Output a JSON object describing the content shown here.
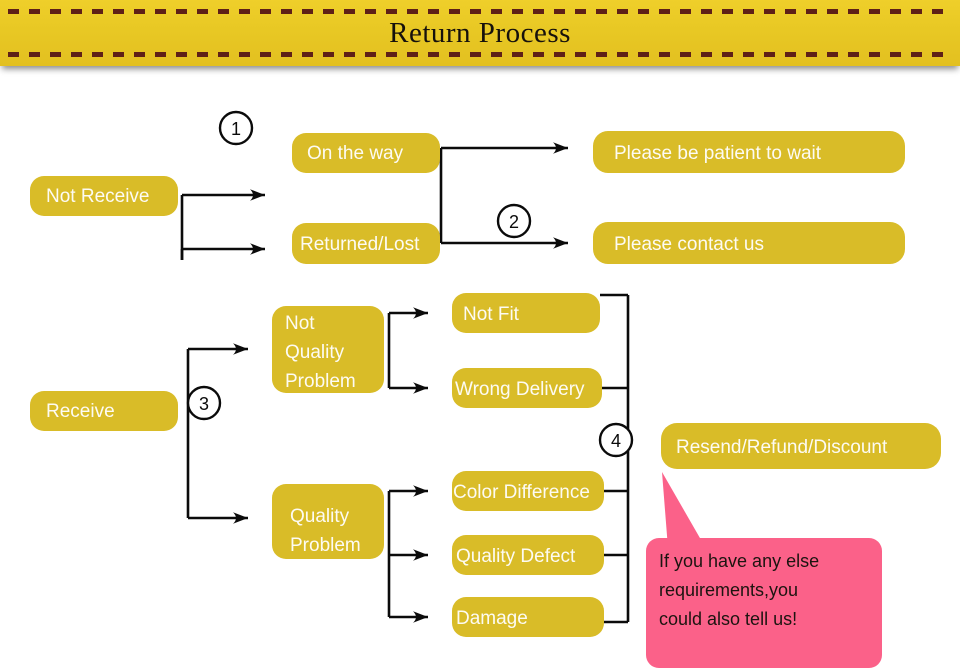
{
  "banner": {
    "title": "Return Process",
    "background_color": "#e8c824",
    "dash_color": "#5e2017"
  },
  "theme": {
    "node_color": "#d9bc28",
    "node_text_color": "#fdfbf3",
    "connector_color": "#0b0b0b",
    "bubble_color": "#fb6189",
    "bubble_text_color": "#1c1410"
  },
  "flow": {
    "branch_not_receive": {
      "root": "Not Receive",
      "marker_1": "1",
      "marker_2": "2",
      "states": [
        "On the way",
        "Returned/Lost"
      ],
      "outcomes": [
        "Please be patient to wait",
        "Please contact us"
      ]
    },
    "branch_receive": {
      "root": "Receive",
      "marker_3": "3",
      "marker_4": "4",
      "categories": [
        "Not Quality Problem",
        "Quality Problem"
      ],
      "not_quality_reasons": [
        "Not Fit",
        "Wrong Delivery"
      ],
      "quality_reasons": [
        "Color Difference",
        "Quality Defect",
        "Damage"
      ],
      "resolution": "Resend/Refund/Discount"
    },
    "callout": {
      "line1": "If you have any else",
      "line2": "requirements,you",
      "line3": "could also tell us!"
    },
    "node_multiline": {
      "not_quality_problem": [
        "Not",
        "Quality",
        "Problem"
      ],
      "quality_problem": [
        "Quality",
        "Problem"
      ]
    }
  }
}
